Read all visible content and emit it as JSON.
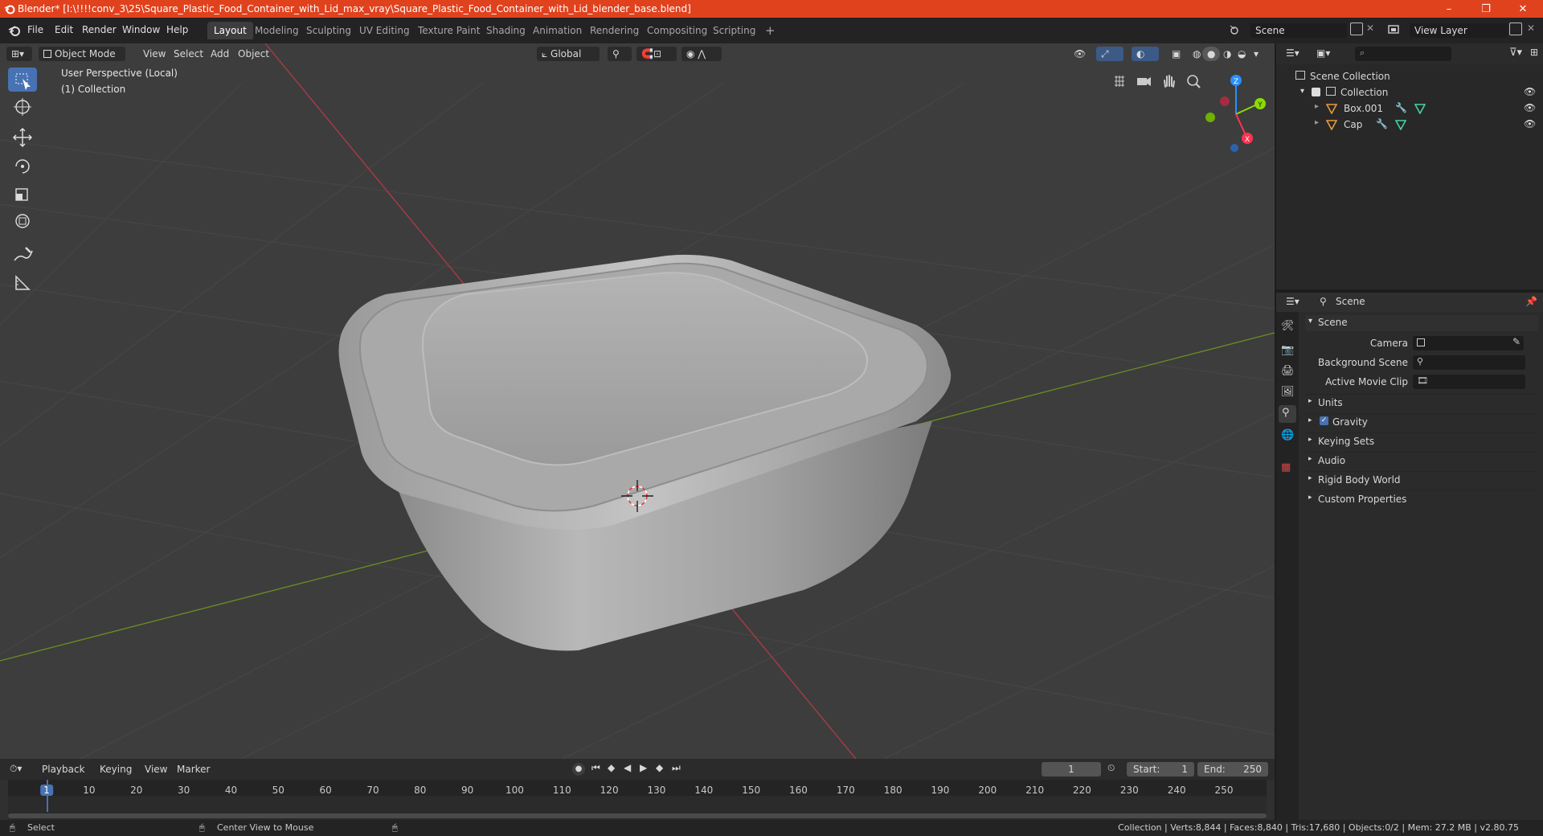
{
  "window": {
    "title": "Blender* [I:\\!!!!conv_3\\25\\Square_Plastic_Food_Container_with_Lid_max_vray\\Square_Plastic_Food_Container_with_Lid_blender_base.blend]",
    "minimize": "–",
    "restore": "❐",
    "close": "✕"
  },
  "menu": [
    "File",
    "Edit",
    "Render",
    "Window",
    "Help"
  ],
  "workspaces": [
    "Layout",
    "Modeling",
    "Sculpting",
    "UV Editing",
    "Texture Paint",
    "Shading",
    "Animation",
    "Rendering",
    "Compositing",
    "Scripting"
  ],
  "workspace_add": "+",
  "scene_field": "Scene",
  "view_layer_field": "View Layer",
  "viewport": {
    "mode": "Object Mode",
    "menus": [
      "View",
      "Select",
      "Add",
      "Object"
    ],
    "orientation": "Global",
    "overlay_line1": "User Perspective (Local)",
    "overlay_line2": "(1) Collection",
    "gizmo": {
      "z": "Z",
      "y": "Y",
      "x": "X"
    }
  },
  "outliner": {
    "root": "Scene Collection",
    "collection": "Collection",
    "objects": [
      "Box.001",
      "Cap"
    ]
  },
  "properties": {
    "header": "Scene",
    "panel": "Scene",
    "fields": [
      {
        "label": "Camera"
      },
      {
        "label": "Background Scene"
      },
      {
        "label": "Active Movie Clip"
      }
    ],
    "sections": [
      "Units",
      "Gravity",
      "Keying Sets",
      "Audio",
      "Rigid Body World",
      "Custom Properties"
    ]
  },
  "timeline": {
    "menus": [
      "Playback",
      "Keying",
      "View",
      "Marker"
    ],
    "current_frame": "1",
    "start_label": "Start:",
    "start": "1",
    "end_label": "End:",
    "end": "250",
    "ticks": [
      "1",
      "10",
      "20",
      "30",
      "40",
      "50",
      "60",
      "70",
      "80",
      "90",
      "100",
      "110",
      "120",
      "130",
      "140",
      "150",
      "160",
      "170",
      "180",
      "190",
      "200",
      "210",
      "220",
      "230",
      "240",
      "250"
    ]
  },
  "status": {
    "left": "Select",
    "middle": "Center View to Mouse",
    "right": "Collection | Verts:8,844 | Faces:8,840 | Tris:17,680 | Objects:0/2 | Mem: 27.2 MB | v2.80.75"
  },
  "colors": {
    "accent": "#4772b3",
    "titlebar": "#e0421e",
    "x_axis": "#ff3352",
    "y_axis": "#8bdc00",
    "z_axis": "#2890ff"
  }
}
